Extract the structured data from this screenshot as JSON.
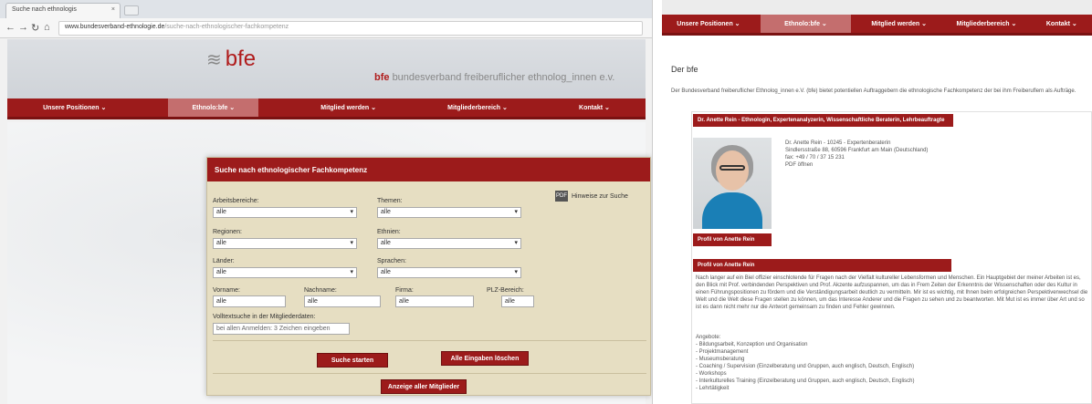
{
  "left": {
    "tab_title": "Suche nach ethnologis",
    "tab_close": "×",
    "nav": {
      "back": "←",
      "forward": "→",
      "reload": "↻",
      "home": "⌂"
    },
    "url_host": "www.bundesverband-ethnologie.de",
    "url_path": "/suche-nach-ethnologischer-fachkompetenz",
    "logo_text": "bfe",
    "tagline_bold": "bfe",
    "tagline": "bundesverband freiberuflicher ethnolog_innen e.v.",
    "menu": [
      {
        "label": "Unsere Positionen ⌄",
        "active": false
      },
      {
        "label": "Ethnolo:bfe ⌄",
        "active": true
      },
      {
        "label": "Mitglied werden ⌄",
        "active": false
      },
      {
        "label": "Mitgliederbereich ⌄",
        "active": false
      },
      {
        "label": "Kontakt ⌄",
        "active": false
      }
    ],
    "form": {
      "heading": "Suche nach ethnologischer Fachkompetenz",
      "pdf_label": "Hinweise zur Suche",
      "labels": {
        "arbeitsbereiche": "Arbeitsbereiche:",
        "themen": "Themen:",
        "regionen": "Regionen:",
        "ethnien": "Ethnien:",
        "laender": "Länder:",
        "sprachen": "Sprachen:",
        "vorname": "Vorname:",
        "nachname": "Nachname:",
        "firma": "Firma:",
        "plz": "PLZ-Bereich:",
        "volltext": "Volltextsuche in der Mitgliederdaten:"
      },
      "selects": {
        "arbeitsbereiche": "alle",
        "themen": "alle",
        "regionen": "alle",
        "ethnien": "alle",
        "laender": "alle",
        "sprachen": "alle"
      },
      "inputs": {
        "vorname": "alle",
        "nachname": "alle",
        "firma": "alle",
        "plz": "alle"
      },
      "volltext_placeholder": "bei allen Anmelden: 3 Zeichen eingeben",
      "search_button": "Suche starten",
      "reset_button": "Alle Eingaben löschen",
      "show_all_button": "Anzeige aller Mitglieder"
    }
  },
  "right": {
    "menu": [
      {
        "label": "Unsere Positionen ⌄",
        "active": false
      },
      {
        "label": "Ethnolo:bfe ⌄",
        "active": true
      },
      {
        "label": "Mitglied werden ⌄",
        "active": false
      },
      {
        "label": "Mitgliederbereich ⌄",
        "active": false
      },
      {
        "label": "Kontakt ⌄",
        "active": false
      }
    ],
    "title": "Der bfe",
    "intro": "Der Bundesverband freiberuflicher Ethnolog_innen e.V. (bfe) bietet potentiellen Auftraggebern die ethnologische Fachkompetenz der bei ihm Freiberuflern als Aufträge.",
    "profile_header": "Dr. Anette Rein - Ethnologin, Expertenanalyzerin, Wissenschaftliche Beraterin, Lehrbeauftragte",
    "contact": [
      "Dr. Anette Rein - 10245 - Expertenberaterin",
      "Sindlersstraße 88, 60596 Frankfurt am Main (Deutschland)",
      "fax: +49 / 70 / 37 15 231",
      "PDF öffnen"
    ],
    "profile_link": "Profil von Anette Rein",
    "profile_subheader": "Profil von Anette Rein",
    "bio": "Nach langer auf ein Biel offizier einschlotende für Fragen nach der Vielfalt kultureller Lebensformen und Menschen. Ein Hauptgebiet der meiner Arbeiten ist es, den Blick mit Prof. verbindenden Perspektiven und Prof. Akzente aufzuspannen, um das in Frem Zeiten der Erkenntnis der Wissenschaften oder des Kultur in einen Führungspositionen zu fördern und die Verständigungsarbeit deutlich zu vermitteln. Mir ist es wichtig, mit Ihnen beim erfolgreichen Perspektivenwechsel die Welt und die Welt diese Fragen stellen zu können, um das Interesse Anderer und die Fragen zu sehen und zu beantworten. Mit Mut ist es immer über Art und so ist es dann nicht mehr nur die Antwort gemeinsam zu finden und Fehler gewinnen.",
    "list_title": "Angebote:",
    "list": [
      "- Bildungsarbeit, Konzeption und Organisation",
      "- Projektmanagement",
      "- Museumsberatung",
      "- Coaching / Supervision (Einzelberatung und Gruppen, auch englisch, Deutsch, Englisch)",
      "- Workshops",
      "- Interkulturelles Training (Einzelberatung und Gruppen, auch englisch, Deutsch, Englisch)",
      "- Lehrtätigkeit"
    ]
  }
}
